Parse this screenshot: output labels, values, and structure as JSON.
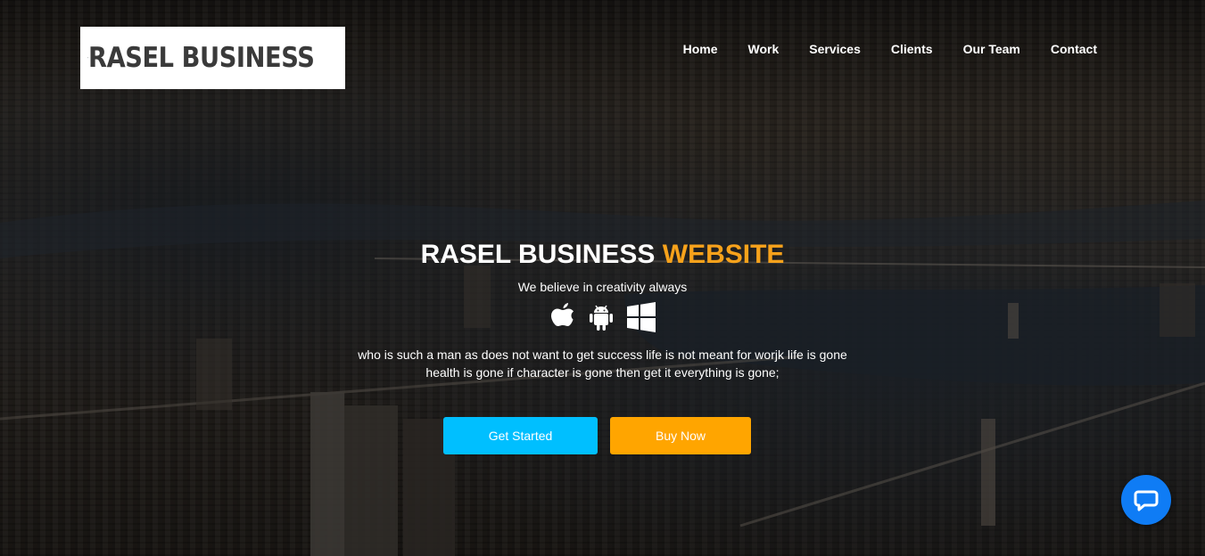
{
  "brand": {
    "name": "RASEL BUSINESS"
  },
  "nav": {
    "items": [
      {
        "label": "Home"
      },
      {
        "label": "Work"
      },
      {
        "label": "Services"
      },
      {
        "label": "Clients"
      },
      {
        "label": "Our Team"
      },
      {
        "label": "Contact"
      }
    ]
  },
  "hero": {
    "title_main": "RASEL BUSINESS",
    "title_accent": "WEBSITE",
    "tagline": "We believe in creativity always",
    "platform_icons": [
      "apple-icon",
      "android-icon",
      "windows-icon"
    ],
    "description_line1": "who is such a man as does not want to get success life is not meant for worjk life is gone",
    "description_line2": "health is gone if character is gone then get it everything is gone;",
    "primary_button": "Get Started",
    "secondary_button": "Buy Now"
  },
  "chat": {
    "icon": "chat-bubble-icon"
  },
  "colors": {
    "accent": "#f7a21b",
    "primary_button": "#00bfff",
    "secondary_button": "#ffa500",
    "chat_button": "#0f7cf5"
  }
}
